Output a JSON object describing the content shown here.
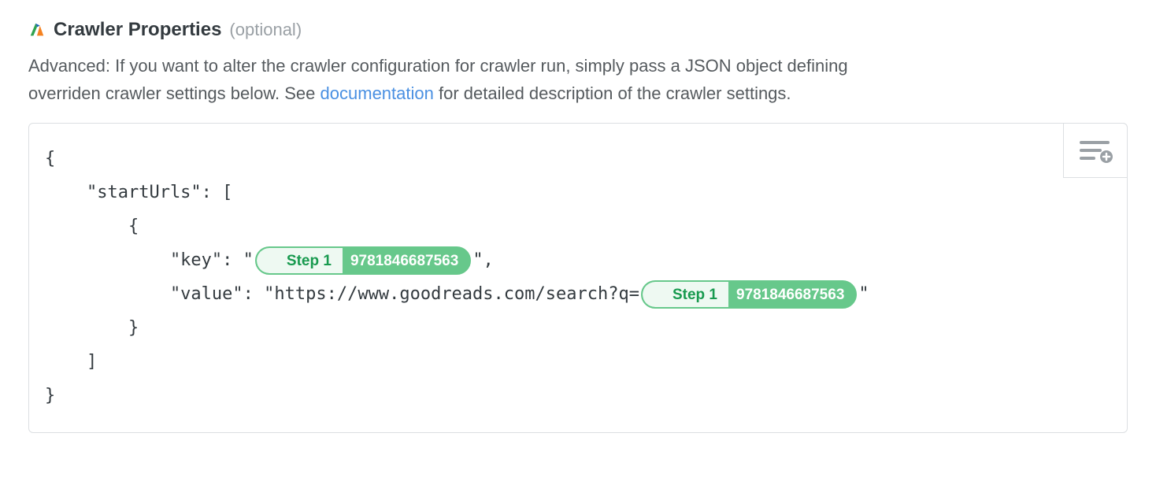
{
  "header": {
    "title": "Crawler Properties",
    "optional": "(optional)"
  },
  "description": {
    "prefix": "Advanced: If you want to alter the crawler configuration for crawler run, simply pass a JSON object defining overriden crawler settings below. See ",
    "link": "documentation",
    "suffix": " for detailed description of the crawler settings."
  },
  "code": {
    "l1": "{",
    "l2": "    \"startUrls\": [",
    "l3": "        {",
    "l4_prefix": "            \"key\": \"",
    "l4_suffix": "\",",
    "l5_prefix": "            \"value\": \"https://www.goodreads.com/search?q=",
    "l5_suffix": "\"",
    "l6": "        }",
    "l7": "    ]",
    "l8": "}"
  },
  "pill": {
    "step_label": "Step 1",
    "value": "9781846687563"
  }
}
